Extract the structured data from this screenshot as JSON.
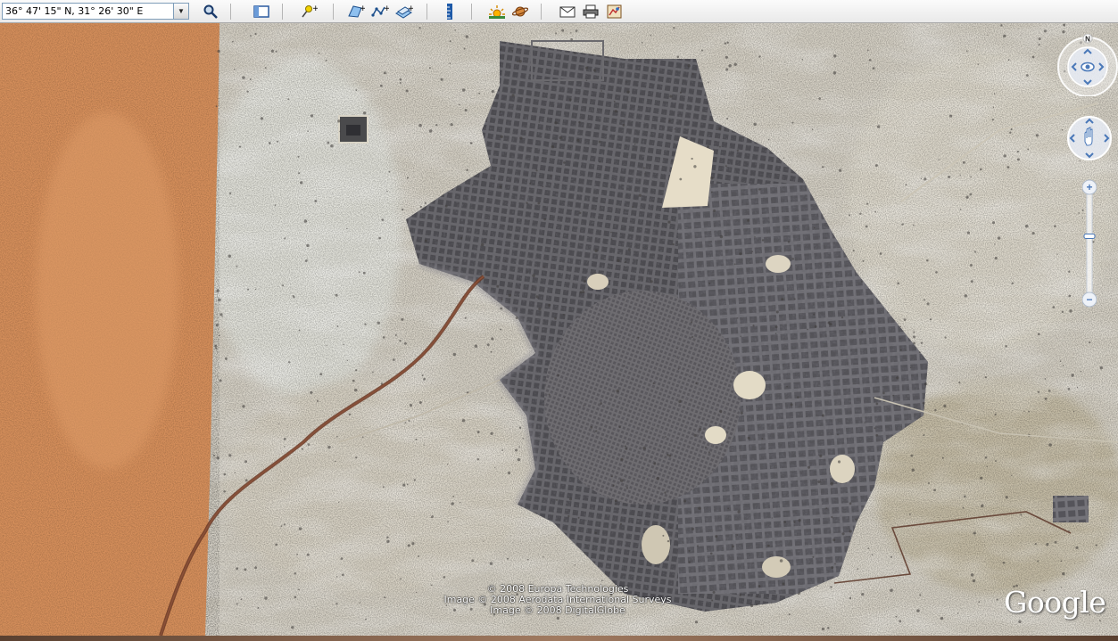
{
  "toolbar": {
    "coordinates_value": "36° 47' 15\" N, 31° 26' 30\" E",
    "dropdown_glyph": "▼",
    "buttons": [
      {
        "name": "search-button",
        "icon": "magnifier-icon"
      },
      {
        "name": "sidebar-toggle-button",
        "icon": "sidebar-icon"
      },
      {
        "name": "add-placemark-button",
        "icon": "placemark-icon"
      },
      {
        "name": "add-polygon-button",
        "icon": "polygon-icon"
      },
      {
        "name": "add-path-button",
        "icon": "path-icon"
      },
      {
        "name": "image-overlay-button",
        "icon": "overlay-icon"
      },
      {
        "name": "ruler-button",
        "icon": "ruler-icon"
      },
      {
        "name": "sunlight-button",
        "icon": "sun-icon"
      },
      {
        "name": "switch-to-sky-button",
        "icon": "planet-icon"
      },
      {
        "name": "email-button",
        "icon": "envelope-icon"
      },
      {
        "name": "print-button",
        "icon": "printer-icon"
      },
      {
        "name": "view-in-maps-button",
        "icon": "map-icon"
      }
    ]
  },
  "map": {
    "attribution_lines": [
      "© 2008 Europa Technologies",
      "Image © 2008 Aerodata International Surveys",
      "Image © 2008 DigitalGlobe"
    ],
    "logo_text": "Google",
    "compass_north_label": "N",
    "zoom_plus_label": "+",
    "zoom_minus_label": "−",
    "zoom_level_fraction": 0.42
  },
  "colors": {
    "desert_orange": "#d7905c",
    "sand_light": "#d9d4c6",
    "city_gray": "#5d5c60",
    "road_brown": "#6b3a26"
  }
}
